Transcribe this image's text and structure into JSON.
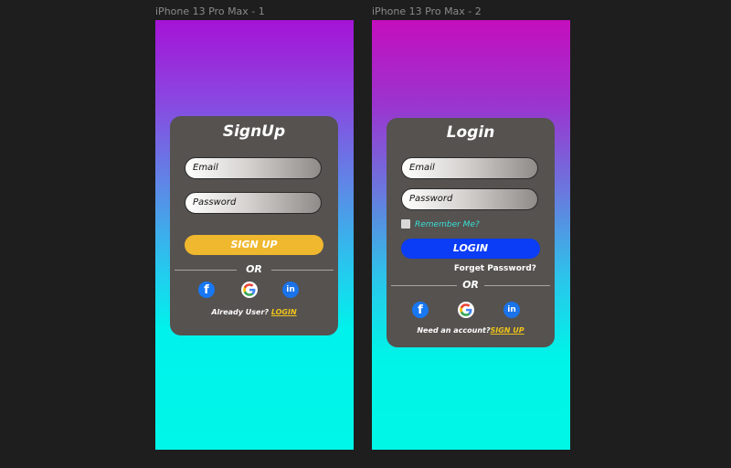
{
  "frames": [
    {
      "label": "iPhone 13 Pro Max - 1",
      "title": "SignUp",
      "email_placeholder": "Email",
      "password_placeholder": "Password",
      "primary_button": "SIGN UP",
      "or_text": "OR",
      "footer_prefix": "Already User? ",
      "footer_link": "LOGIN"
    },
    {
      "label": "iPhone 13 Pro Max - 2",
      "title": "Login",
      "email_placeholder": "Email",
      "password_placeholder": "Password",
      "remember_label": "Remember Me?",
      "primary_button": "LOGIN",
      "forget_link": "Forget Password?",
      "or_text": "OR",
      "footer_prefix": "Need an account?",
      "footer_link": "SIGN UP"
    }
  ],
  "social": {
    "facebook_glyph": "f",
    "linkedin_glyph": "in"
  },
  "colors": {
    "card": "#555250",
    "signup_button": "#f0b82e",
    "login_button": "#0b3cf6",
    "link_accent": "#f0c419",
    "remember_text": "#39e0d6"
  },
  "icons": [
    "facebook-icon",
    "google-icon",
    "linkedin-icon",
    "checkbox-icon"
  ]
}
